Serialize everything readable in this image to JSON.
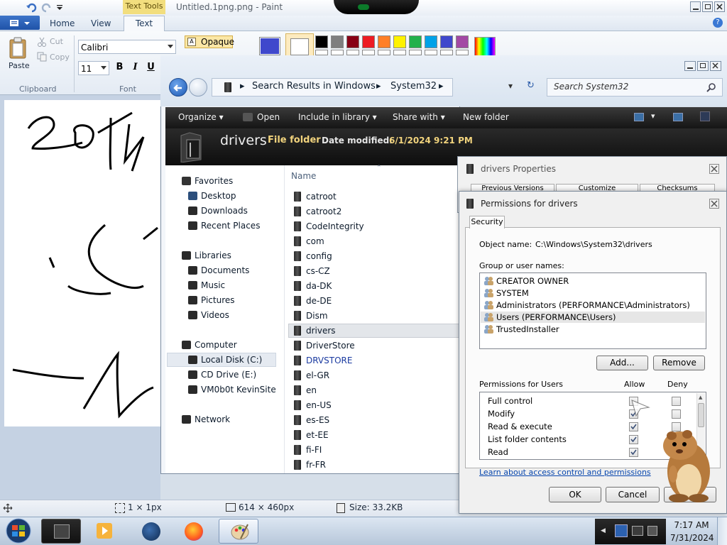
{
  "paint": {
    "title": "Untitled.1png.png - Paint",
    "contextual_tab": "Text Tools",
    "tabs": [
      "Home",
      "View",
      "Text"
    ],
    "clipboard": {
      "paste": "Paste",
      "cut": "Cut",
      "copy": "Copy",
      "group": "Clipboard"
    },
    "font": {
      "family": "Calibri",
      "size": "11",
      "group": "Font",
      "bold": "B",
      "italic": "I",
      "underline": "U"
    },
    "background": {
      "opaque": "Opaque"
    },
    "status": {
      "selection_size": "1 × 1px",
      "canvas_size": "614 × 460px",
      "file_size": "Size: 33.2KB"
    },
    "palette": [
      "#000000",
      "#7f7f7f",
      "#880015",
      "#ed1c24",
      "#ff7f27",
      "#fff200",
      "#22b14c",
      "#00a2e8",
      "#3f48cc",
      "#a349a4"
    ],
    "color1": "#3f48cc",
    "color2": "#ffffff"
  },
  "explorer": {
    "breadcrumb": [
      "Search Results in Windows",
      "System32"
    ],
    "search_placeholder": "Search System32",
    "toolbar": {
      "organize": "Organize",
      "open": "Open",
      "include": "Include in library",
      "share": "Share with",
      "new_folder": "New folder"
    },
    "details": {
      "name": "drivers",
      "type": "File folder",
      "modified_label": "Date modified:",
      "modified_value": "6/1/2024 9:21 PM"
    },
    "nav": {
      "favorites": "Favorites",
      "desktop": "Desktop",
      "downloads": "Downloads",
      "recent": "Recent Places",
      "libraries": "Libraries",
      "documents": "Documents",
      "music": "Music",
      "pictures": "Pictures",
      "videos": "Videos",
      "computer": "Computer",
      "local_disk": "Local Disk (C:)",
      "cd_drive": "CD Drive (E:)",
      "vm": "VM0b0t KevinSite",
      "network": "Network"
    },
    "column_name": "Name",
    "files": [
      "catroot",
      "catroot2",
      "CodeIntegrity",
      "com",
      "config",
      "cs-CZ",
      "da-DK",
      "de-DE",
      "Dism",
      "drivers",
      "DriverStore",
      "DRVSTORE",
      "el-GR",
      "en",
      "en-US",
      "es-ES",
      "et-EE",
      "fi-FI",
      "fr-FR"
    ],
    "selected_file": "drivers"
  },
  "properties": {
    "title": "drivers Properties",
    "tabs": [
      "Previous Versions",
      "Customize",
      "Checksums"
    ]
  },
  "permissions": {
    "title": "Permissions for drivers",
    "tab": "Security",
    "object_label": "Object name:",
    "object_value": "C:\\Windows\\System32\\drivers",
    "group_label": "Group or user names:",
    "users": [
      "CREATOR OWNER",
      "SYSTEM",
      "Administrators (PERFORMANCE\\Administrators)",
      "Users (PERFORMANCE\\Users)",
      "TrustedInstaller"
    ],
    "add": "Add...",
    "remove": "Remove",
    "perm_label": "Permissions for Users",
    "allow": "Allow",
    "deny": "Deny",
    "perms": [
      {
        "name": "Full control",
        "allow": false,
        "deny": false
      },
      {
        "name": "Modify",
        "allow": true,
        "deny": false
      },
      {
        "name": "Read & execute",
        "allow": true,
        "deny": false
      },
      {
        "name": "List folder contents",
        "allow": true,
        "deny": false
      },
      {
        "name": "Read",
        "allow": true,
        "deny": false
      }
    ],
    "link": "Learn about access control and permissions",
    "ok": "OK",
    "cancel": "Cancel"
  },
  "taskbar": {
    "time": "7:17 AM",
    "date": "7/31/2024"
  }
}
